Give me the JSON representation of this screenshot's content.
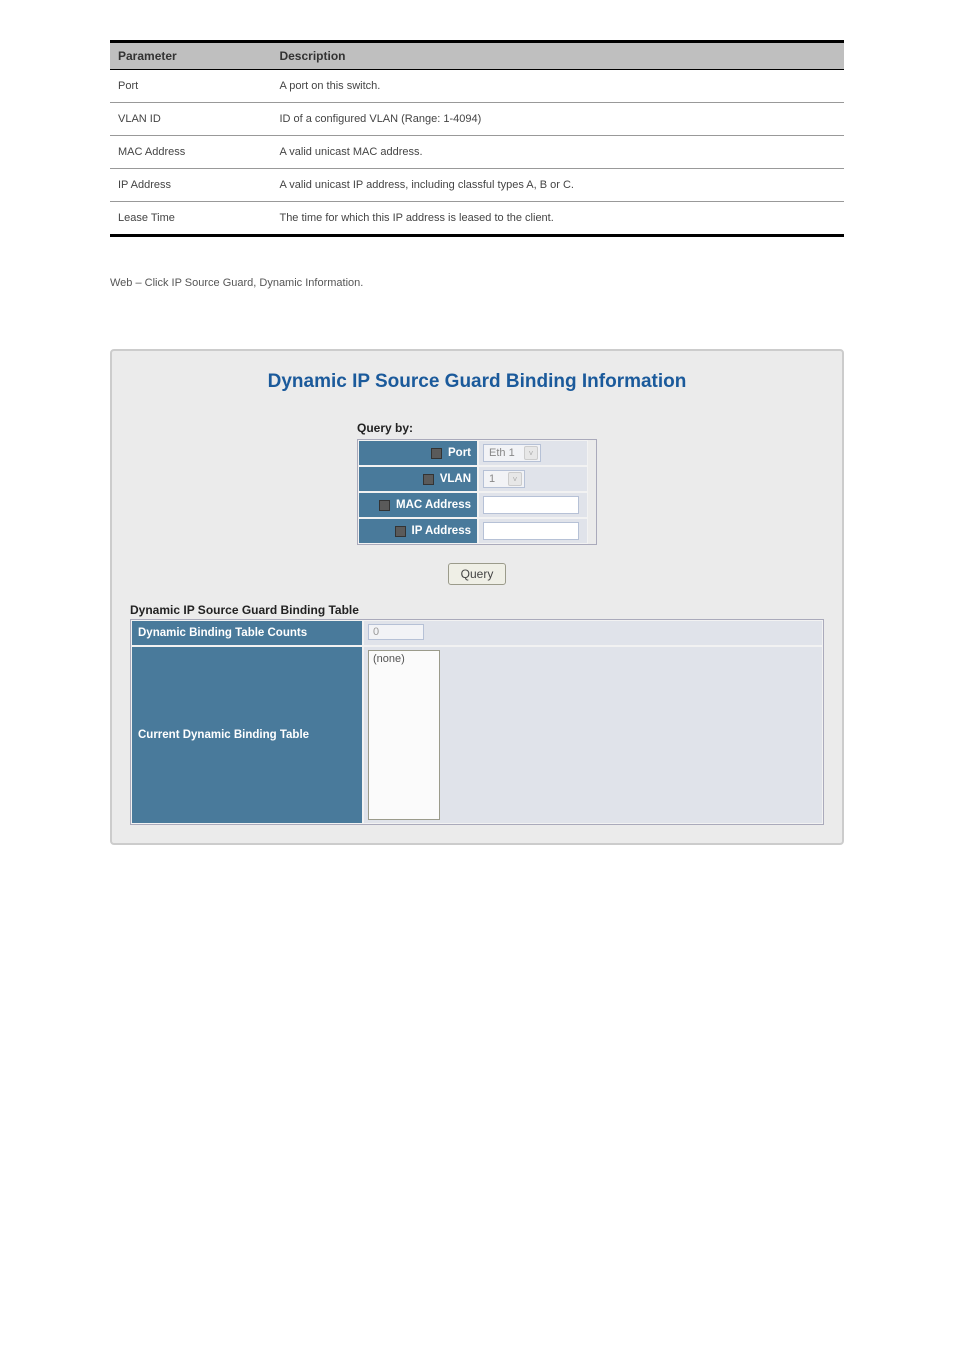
{
  "params_header": {
    "c1": "Parameter",
    "c2": "Description"
  },
  "params": [
    {
      "name": "Port",
      "desc": "A port on this switch."
    },
    {
      "name": "VLAN ID",
      "desc": "ID of a configured VLAN (Range: 1-4094)"
    },
    {
      "name": "MAC Address",
      "desc": "A valid unicast MAC address."
    },
    {
      "name": "IP Address",
      "desc": "A valid unicast IP address, including classful types A, B or C."
    },
    {
      "name": "Lease Time",
      "desc": "The time for which this IP address is leased to the client."
    }
  ],
  "web_text": "Web – Click IP Source Guard, Dynamic Information.",
  "ui": {
    "title": "Dynamic IP Source Guard Binding Information",
    "query_by": "Query by:",
    "fields": {
      "port": {
        "label": "Port",
        "value": "Eth 1"
      },
      "vlan": {
        "label": "VLAN",
        "value": "1"
      },
      "mac": {
        "label": "MAC Address",
        "value": ""
      },
      "ip": {
        "label": "IP Address",
        "value": ""
      }
    },
    "query_btn": "Query",
    "table": {
      "title": "Dynamic IP Source Guard Binding Table",
      "counts_label": "Dynamic Binding Table Counts",
      "counts_value": "0",
      "current_label": "Current Dynamic Binding Table",
      "current_value": "(none)"
    }
  }
}
